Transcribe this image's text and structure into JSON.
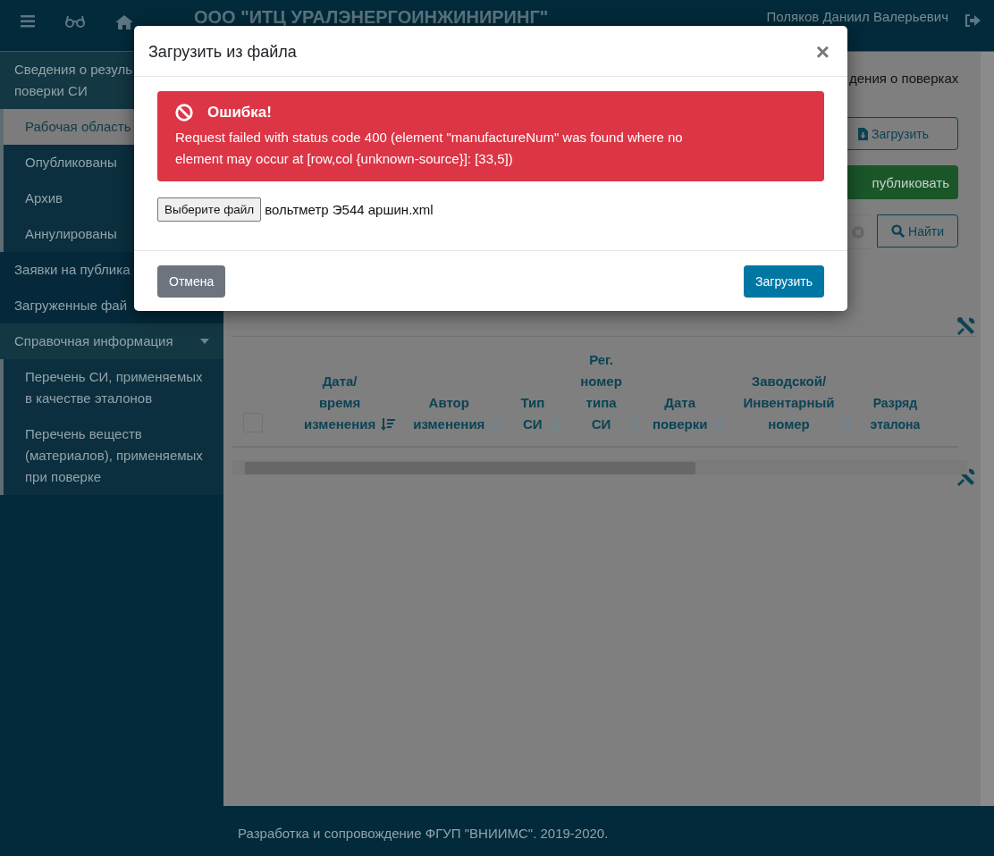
{
  "header": {
    "title": "ООО \"ИТЦ УРАЛЭНЕРГОИНЖИНИРИНГ\"",
    "user": "Поляков Даниил Валерьевич"
  },
  "sidebar": {
    "items": [
      {
        "label": "Сведения о резуль\nповерки СИ",
        "children": [
          {
            "label": "Рабочая область",
            "selected": true
          },
          {
            "label": "Опубликованы",
            "selected": false
          },
          {
            "label": "Архив",
            "selected": false
          },
          {
            "label": "Аннулированы",
            "selected": false
          }
        ]
      },
      {
        "label": "Заявки на публика"
      },
      {
        "label": "Загруженные фай"
      },
      {
        "label": "Справочная информация",
        "expanded": true,
        "children": [
          {
            "label": "Перечень СИ, применяемых в качестве эталонов",
            "selected": false
          },
          {
            "label": "Перечень веществ (материалов), применяемых при поверке",
            "selected": false
          }
        ]
      }
    ]
  },
  "main": {
    "breadcrumb": "дения о поверках",
    "upload_button": "Загрузить",
    "publish_button": "публиковать",
    "search_button": "Найти",
    "table": {
      "columns": [
        {
          "label": "Дата/\nвремя\nизменения",
          "sorted": true
        },
        {
          "label": "Автор\nизменения",
          "sorted": false
        },
        {
          "label": "Тип\nСИ",
          "sorted": false
        },
        {
          "label": "Рег.\nномер\nтипа\nСИ",
          "sorted": false
        },
        {
          "label": "Дата\nповерки",
          "sorted": false
        },
        {
          "label": "Заводской/\nИнвентарный\nномер",
          "sorted": false
        },
        {
          "label": "Разряд\nэталона"
        }
      ],
      "select_all": {
        "checked": false
      }
    }
  },
  "footer": {
    "text": "Разработка и сопровождение ФГУП \"ВНИИМС\". 2019-2020."
  },
  "modal": {
    "title": "Загрузить из файла",
    "close": "×",
    "alert": {
      "title": "Ошибка!",
      "message": "Request failed with status code 400 (element \"manufactureNum\" was found where no element may occur at [row,col {unknown-source}]: [33,5])"
    },
    "file_button": "Выберите файл",
    "file_name": "вольтметр Э544 аршин.xml",
    "cancel_button": "Отмена",
    "submit_button": "Загрузить"
  }
}
